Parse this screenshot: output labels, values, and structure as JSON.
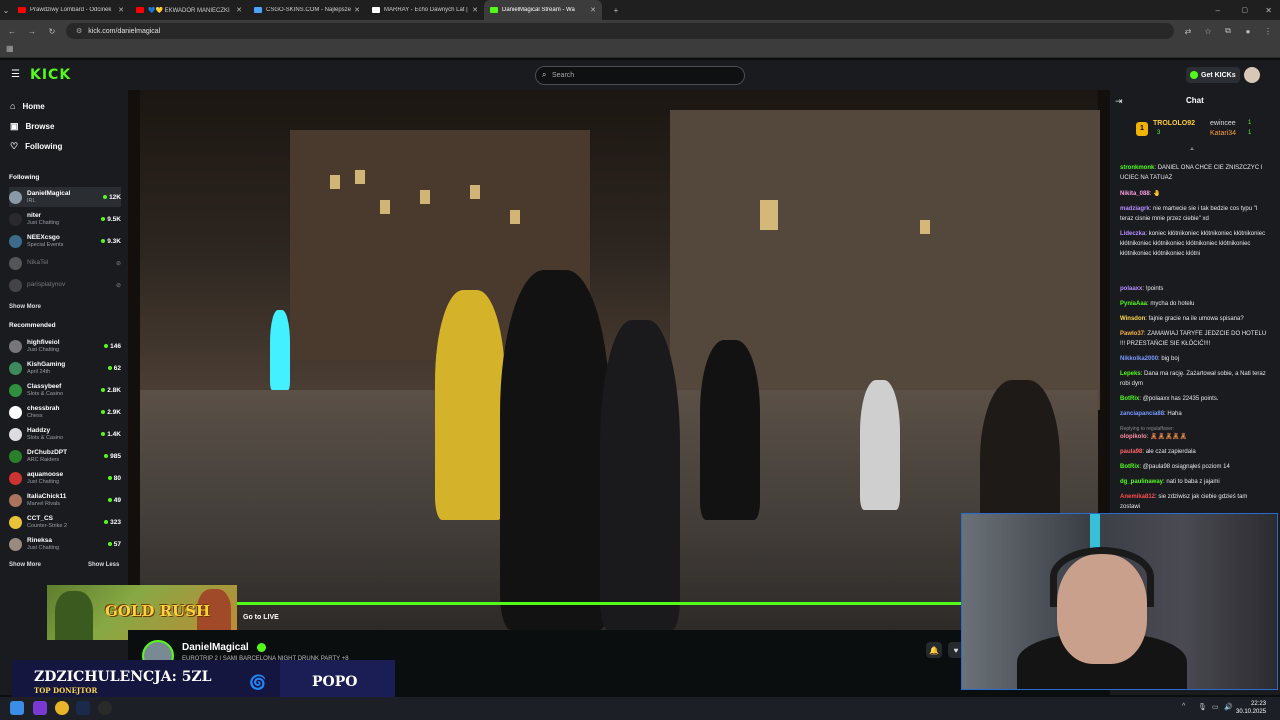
{
  "browser": {
    "tabs": [
      {
        "label": "Prawdziwy Lombard - Odcinek",
        "color": "#ff0000"
      },
      {
        "label": "💙💛 EKWADOR MANIECZKI",
        "color": "#ff0000"
      },
      {
        "label": "CSGO-SKINS.COM - Najlepsze",
        "color": "#4aa3ff"
      },
      {
        "label": "MARRAY - Echo Dawnych Lat |",
        "color": "#ffffff"
      },
      {
        "label": "DanielMagical Stream - Wa",
        "color": "#53fc18",
        "active": true
      }
    ],
    "url": "kick.com/danielmagical"
  },
  "header": {
    "logo": "KICK",
    "search_placeholder": "Search",
    "get_kicks_label": "Get KICKs"
  },
  "sidebar": {
    "nav": [
      {
        "label": "Home",
        "icon": "home-icon"
      },
      {
        "label": "Browse",
        "icon": "browse-icon"
      },
      {
        "label": "Following",
        "icon": "heart-icon"
      }
    ],
    "following_title": "Following",
    "following": [
      {
        "name": "DanielMagical",
        "category": "IRL",
        "viewers": "12K",
        "color": "#8a9aa4"
      },
      {
        "name": "niter",
        "category": "Just Chatting",
        "viewers": "9.5K",
        "color": "#2a2a2a"
      },
      {
        "name": "NEEXcsgo",
        "category": "Special Events",
        "viewers": "9.3K",
        "color": "#3d6c8a"
      },
      {
        "name": "NikaTel",
        "category": "",
        "viewers": "",
        "offline": true,
        "color": "#555"
      },
      {
        "name": "parisplatynov",
        "category": "",
        "viewers": "",
        "offline": true,
        "color": "#444"
      }
    ],
    "show_more_1": "Show More",
    "recommended_title": "Recommended",
    "recommended": [
      {
        "name": "highfiveiol",
        "category": "Just Chatting",
        "viewers": "146",
        "color": "#777"
      },
      {
        "name": "KishGaming",
        "category": "April 24th",
        "viewers": "62",
        "color": "#3c8a5a"
      },
      {
        "name": "Classybeef",
        "category": "Slots & Casino",
        "viewers": "2.8K",
        "color": "#2f8f3f"
      },
      {
        "name": "chessbrah",
        "category": "Chess",
        "viewers": "2.9K",
        "color": "#fff"
      },
      {
        "name": "Haddzy",
        "category": "Slots & Casino",
        "viewers": "1.4K",
        "color": "#ddd"
      },
      {
        "name": "DrChubzDPT",
        "category": "ARC Raiders",
        "viewers": "985",
        "color": "#2a7f2a"
      },
      {
        "name": "aquamoose",
        "category": "Just Chatting",
        "viewers": "80",
        "color": "#c33"
      },
      {
        "name": "ItaliaChick11",
        "category": "Marvel Rivals",
        "viewers": "49",
        "color": "#a9735e"
      },
      {
        "name": "CCT_CS",
        "category": "Counter-Strike 2",
        "viewers": "323",
        "color": "#e9c23a"
      },
      {
        "name": "Rineksa",
        "category": "Just Chatting",
        "viewers": "57",
        "color": "#9a8a80"
      }
    ],
    "show_more_2": "Show More",
    "show_less": "Show Less"
  },
  "player": {
    "go_to_live": "Go to LIVE",
    "game_banner": "GOLD RUSH"
  },
  "stream": {
    "streamer": "DanielMagical",
    "title": "EUROTRIP 2 | SAMI BARCELONA NIGHT DRUNK PARTY +8"
  },
  "donation": {
    "main": "ZDZICHULENCJA: 5ZL",
    "sub": "TOP DONEJTOR",
    "name": "POPO"
  },
  "chat": {
    "title": "Chat",
    "pinned": {
      "rank": "1",
      "top_user": "TROLOLO92",
      "top_count": "3",
      "user2": "ewincee",
      "user2_count": "1",
      "user3": "Katari34",
      "user3_count": "1"
    },
    "messages": [
      {
        "user": "stronkmonk",
        "color": "#53fc18",
        "text": "DANIEL ONA CHCE CIE ZNISZCZYC I UCIEC NA TATUAZ"
      },
      {
        "user": "Nikita_088",
        "color": "#ff9de0",
        "text": "🤚"
      },
      {
        "user": "madziagrk",
        "color": "#b98cff",
        "text": "nie martwcie sie i tak bedzie cos typu \"I teraz cisnie mnie przez ciebie\" xd"
      },
      {
        "user": "Lideczka",
        "color": "#b98cff",
        "text": "koniec kłótnikoniec kłótnikoniec kłótnikoniec kłótnikoniec kłótnikoniec kłótnikoniec kłótnikoniec kłótnikoniec kłótnikoniec kłótni"
      },
      {
        "user": "polaaxx",
        "color": "#b98cff",
        "text": "!points"
      },
      {
        "user": "PyniaAaa",
        "color": "#53fc18",
        "text": "mycha do hotelu"
      },
      {
        "user": "Winsdon",
        "color": "#ffd84a",
        "text": "fajnie gracie na ile umowa spisana?"
      },
      {
        "user": "Pawlo37",
        "color": "#ffb347",
        "text": "ZAMAWIAJ TARYFE JEDZCIE DO HOTELU !!! PRZESTAŃCIE SIE KŁÓCIĆ!!!!"
      },
      {
        "user": "Nikkolka2000",
        "color": "#7a9bff",
        "text": "big boj"
      },
      {
        "user": "Lepeks",
        "color": "#53fc18",
        "text": "Dana ma rację. Zażartował sobie, a Nati teraz robi dym"
      },
      {
        "user": "BotRix",
        "color": "#53fc18",
        "text": "@polaaxx has 22435 points."
      },
      {
        "user": "zanciapancia88",
        "color": "#7a9bff",
        "text": "Haha"
      },
      {
        "user": "olopikolo",
        "color": "#ff8fa3",
        "text": "🧸🧸🧸🧸🧸"
      },
      {
        "user": "paula98",
        "color": "#ff6666",
        "text": "ale czat zapierdala"
      },
      {
        "user": "BotRix",
        "color": "#53fc18",
        "text": "@paula98 osiągnąłeś poziom 14"
      },
      {
        "user": "dg_paulinaway",
        "color": "#53fc18",
        "text": "nati to baba z jajami"
      },
      {
        "user": "Anemika812",
        "color": "#ff4d4d",
        "text": "sie zdziwisz jak ciebie gdzieś tam zostawi"
      }
    ],
    "reply_note": "Replying to regulaffaxer:"
  },
  "taskbar": {
    "time": "22:23",
    "date": "30.10.2025"
  }
}
